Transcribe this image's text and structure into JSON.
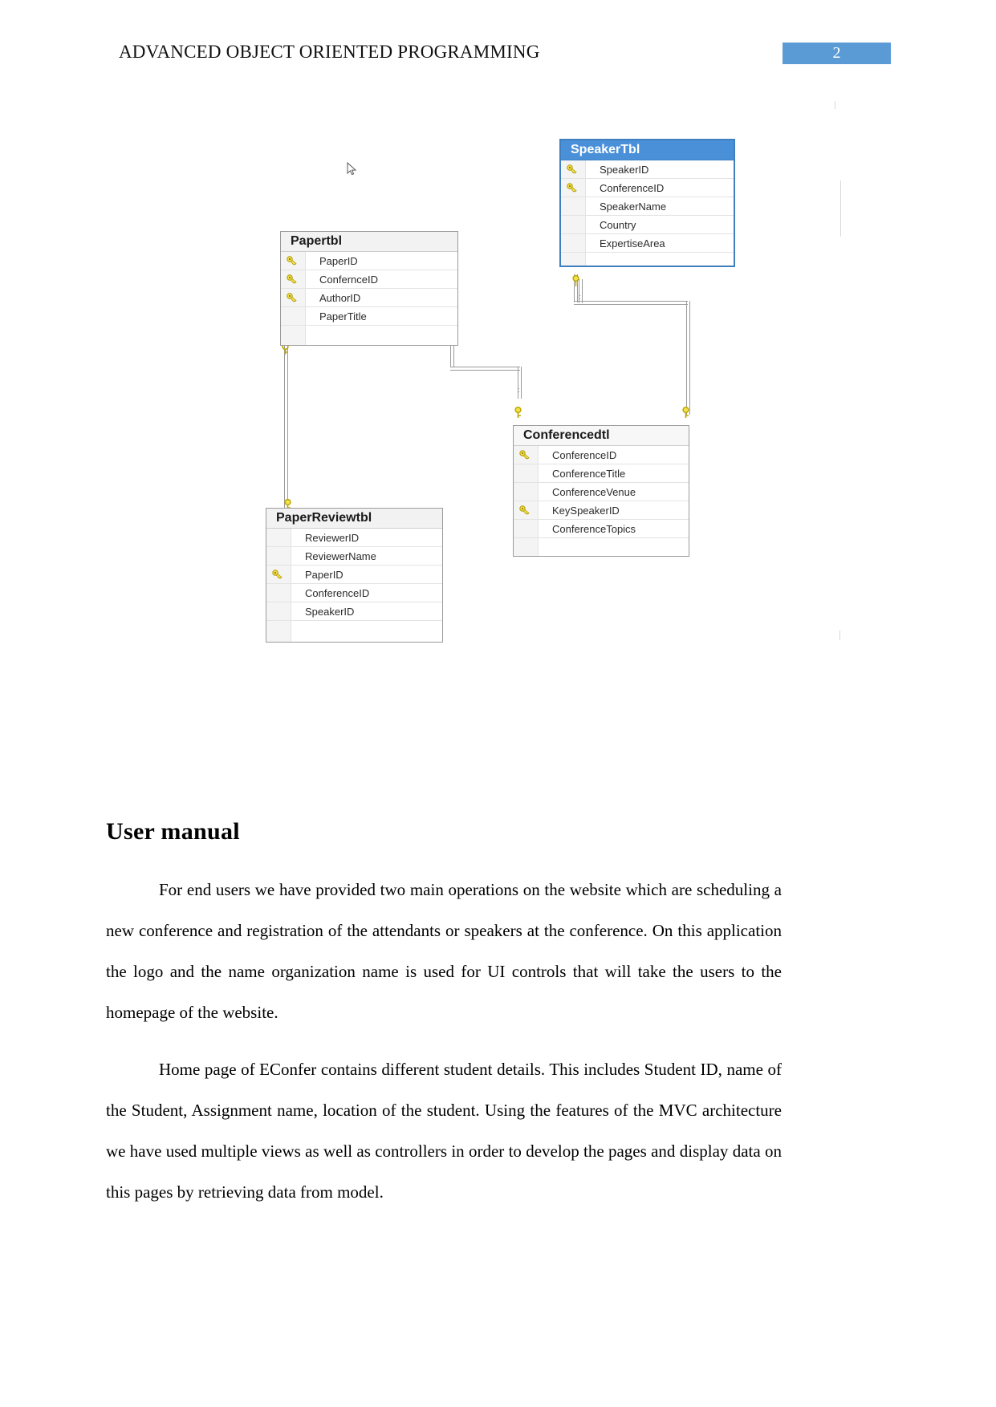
{
  "header": {
    "title": "ADVANCED OBJECT ORIENTED PROGRAMMING",
    "page_number": "2",
    "badge_color": "#5b9bd5"
  },
  "diagram": {
    "name": "entity-relationship-diagram",
    "tables": [
      {
        "id": "speaker",
        "title": "SpeakerTbl",
        "selected": true,
        "header_color": "#4a90d9",
        "border_color": "#3f7fbf",
        "rows": [
          {
            "name": "SpeakerID",
            "key": true
          },
          {
            "name": "ConferenceID",
            "key": true
          },
          {
            "name": "SpeakerName",
            "key": false
          },
          {
            "name": "Country",
            "key": false
          },
          {
            "name": "ExpertiseArea",
            "key": false
          }
        ]
      },
      {
        "id": "paper",
        "title": "Papertbl",
        "selected": false,
        "header_color": "#f2f2f2",
        "border_color": "#9a9a9a",
        "rows": [
          {
            "name": "PaperID",
            "key": true
          },
          {
            "name": "ConfernceID",
            "key": true
          },
          {
            "name": "AuthorID",
            "key": true
          },
          {
            "name": "PaperTitle",
            "key": false
          }
        ]
      },
      {
        "id": "conference",
        "title": "Conferencedtl",
        "selected": false,
        "header_color": "#f7f7f7",
        "border_color": "#9a9a9a",
        "rows": [
          {
            "name": "ConferenceID",
            "key": true
          },
          {
            "name": "ConferenceTitle",
            "key": false
          },
          {
            "name": "ConferenceVenue",
            "key": false
          },
          {
            "name": "KeySpeakerID",
            "key": true
          },
          {
            "name": "ConferenceTopics",
            "key": false
          }
        ]
      },
      {
        "id": "paperreview",
        "title": "PaperReviewtbl",
        "selected": false,
        "header_color": "#f2f2f2",
        "border_color": "#9a9a9a",
        "rows": [
          {
            "name": "ReviewerID",
            "key": false
          },
          {
            "name": "ReviewerName",
            "key": false
          },
          {
            "name": "PaperID",
            "key": true
          },
          {
            "name": "ConferenceID",
            "key": false
          },
          {
            "name": "SpeakerID",
            "key": false
          }
        ]
      }
    ],
    "relationship_count": 4,
    "icons": {
      "key": "key-icon",
      "pointer": "mouse-pointer-icon"
    }
  },
  "content": {
    "heading": "User manual",
    "paragraphs": [
      "For end users we have provided two main operations on the website which are scheduling a new conference and registration of the attendants or speakers at the conference. On this application the logo and the name organization name is used for UI controls that will take the users to the homepage of the website.",
      "Home page of EConfer contains different student details.  This includes Student ID, name of the Student, Assignment name, location of the student.  Using the features of the MVC architecture we have used multiple views as well as controllers in order to develop the pages and display data on this pages by retrieving data from model."
    ]
  }
}
